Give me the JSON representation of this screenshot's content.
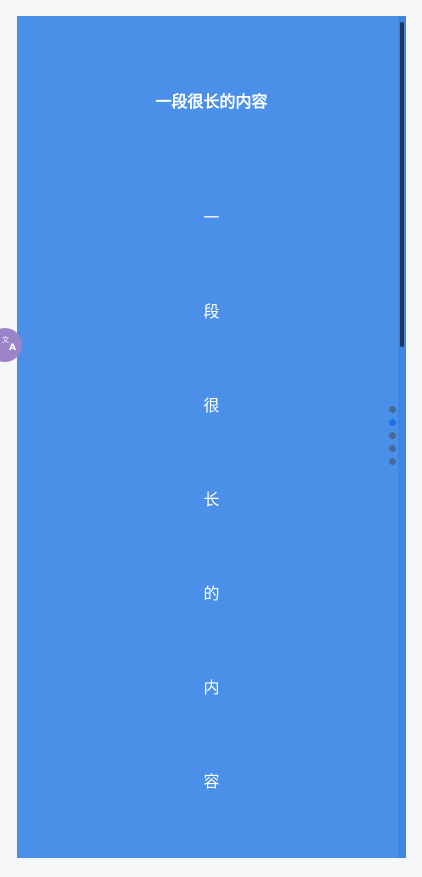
{
  "content": {
    "title": "一段很长的内容",
    "characters": [
      "一",
      "段",
      "很",
      "长",
      "的",
      "内",
      "容"
    ]
  },
  "pager": {
    "total": 5,
    "active_index": 1
  },
  "scrollbar": {
    "position_fraction": 0.0,
    "visible_fraction": 0.39
  },
  "icons": {
    "translate": "translate-icon"
  },
  "colors": {
    "background": "#f5f6f7",
    "panel": "#4a90e9",
    "text": "#ffffff",
    "scroll_thumb": "#1c3760",
    "dot_inactive": "#476a98",
    "dot_active": "#1f6ff0",
    "translate_fab": "#9d84c9"
  }
}
